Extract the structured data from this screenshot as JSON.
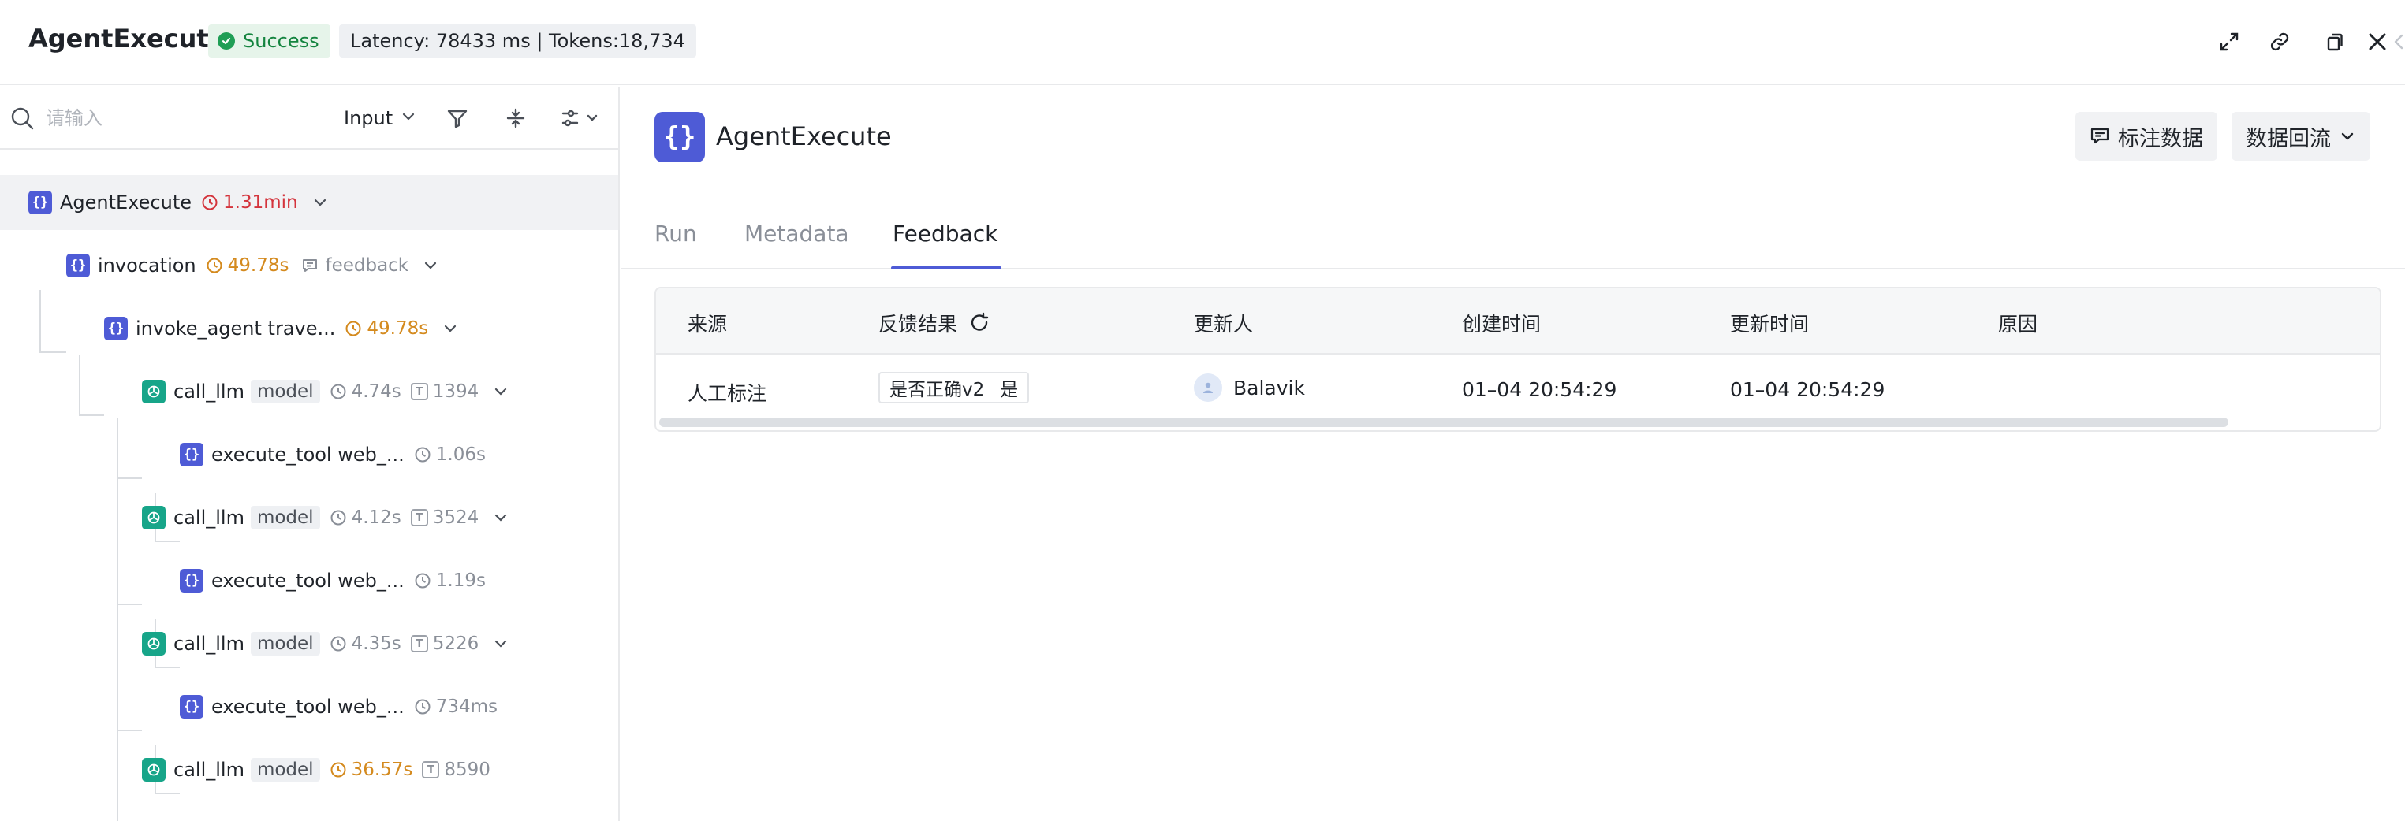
{
  "header": {
    "title": "AgentExecute",
    "status": "Success",
    "meta": "Latency: 78433 ms | Tokens:18,734"
  },
  "left": {
    "search_placeholder": "请输入",
    "input_select": "Input",
    "tree": [
      {
        "name": "AgentExecute",
        "icon": "braces-icon",
        "time": "1.31min",
        "time_color": "#d4343c",
        "expand": true
      },
      {
        "name": "invocation",
        "icon": "braces-icon",
        "time": "49.78s",
        "time_color": "#d48a1e",
        "feedback": "feedback",
        "expand": true
      },
      {
        "name": "invoke_agent trave...",
        "icon": "braces-icon",
        "time": "49.78s",
        "time_color": "#d48a1e",
        "expand": true
      },
      {
        "name": "call_llm",
        "tag": "model",
        "icon": "llm-icon",
        "time": "4.74s",
        "tokens": "1394",
        "expand": true
      },
      {
        "name": "execute_tool web_...",
        "icon": "braces-icon",
        "time": "1.06s"
      },
      {
        "name": "call_llm",
        "tag": "model",
        "icon": "llm-icon",
        "time": "4.12s",
        "tokens": "3524",
        "expand": true
      },
      {
        "name": "execute_tool web_...",
        "icon": "braces-icon",
        "time": "1.19s"
      },
      {
        "name": "call_llm",
        "tag": "model",
        "icon": "llm-icon",
        "time": "4.35s",
        "tokens": "5226",
        "expand": true
      },
      {
        "name": "execute_tool web_...",
        "icon": "braces-icon",
        "time": "734ms"
      },
      {
        "name": "call_llm",
        "tag": "model",
        "icon": "llm-icon",
        "time": "36.57s",
        "time_color": "#d48a1e",
        "tokens": "8590"
      }
    ]
  },
  "right": {
    "title": "AgentExecute",
    "annotate_button": "标注数据",
    "backflow_button": "数据回流",
    "tabs": [
      "Run",
      "Metadata",
      "Feedback"
    ],
    "active_tab": "Feedback",
    "table": {
      "headers": [
        "来源",
        "反馈结果",
        "更新人",
        "创建时间",
        "更新时间",
        "原因"
      ],
      "rows": [
        {
          "source": "人工标注",
          "feedback_key": "是否正确v2",
          "feedback_value": "是",
          "updater": "Balavik",
          "created": "01–04 20:54:29",
          "updated": "01–04 20:54:29",
          "reason": ""
        }
      ]
    }
  },
  "colors": {
    "accent": "#4e5bd6",
    "success": "#1f9e55",
    "llm": "#17a589",
    "warn": "#d48a1e",
    "danger": "#d4343c"
  }
}
